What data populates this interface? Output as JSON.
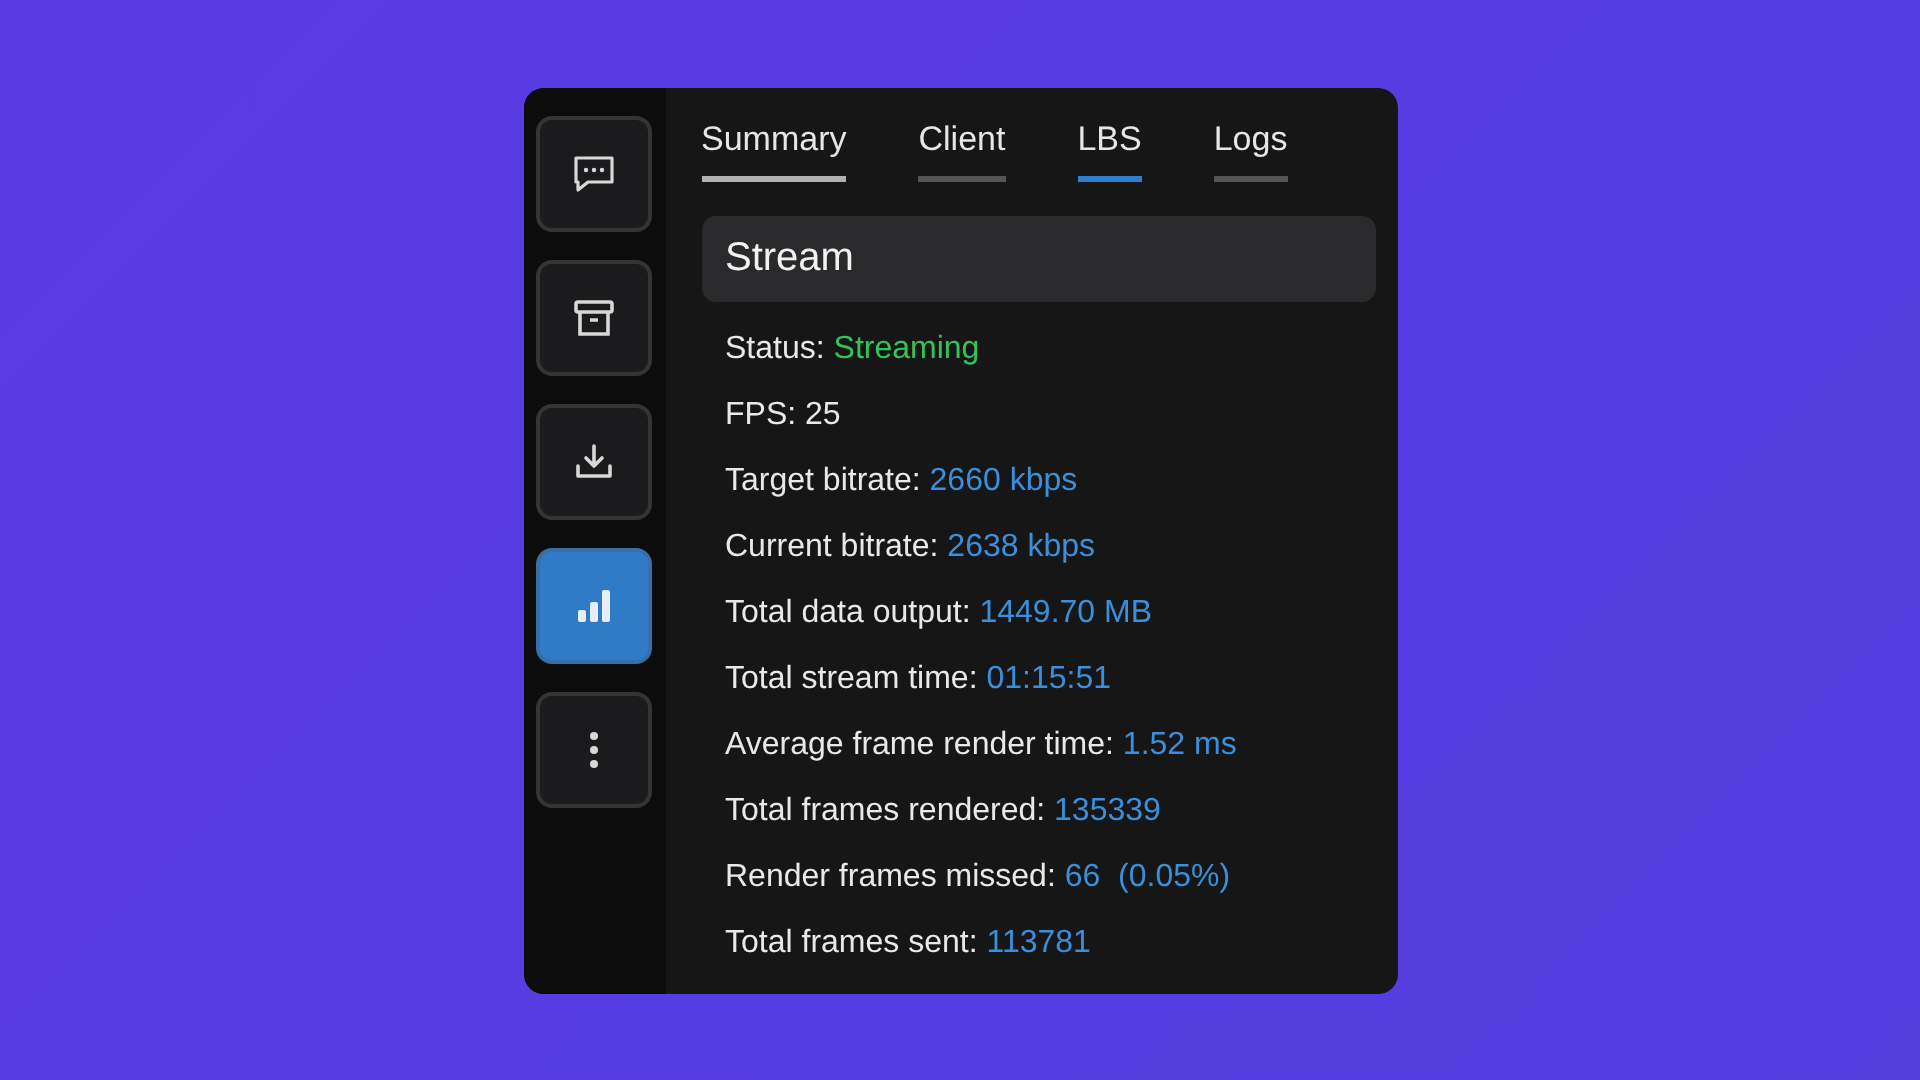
{
  "sidebar": {
    "items": [
      {
        "kind": "chat",
        "selected": false
      },
      {
        "kind": "archive",
        "selected": false
      },
      {
        "kind": "download",
        "selected": false
      },
      {
        "kind": "chart",
        "selected": true
      },
      {
        "kind": "more",
        "selected": false
      }
    ]
  },
  "tabs": [
    {
      "label": "Summary",
      "selected": false,
      "hovered": true
    },
    {
      "label": "Client",
      "selected": false,
      "hovered": false
    },
    {
      "label": "LBS",
      "selected": true,
      "hovered": false
    },
    {
      "label": "Logs",
      "selected": false,
      "hovered": false
    }
  ],
  "section": {
    "title": "Stream"
  },
  "stats": [
    {
      "label": "Status:",
      "value": "Streaming",
      "kind": "status"
    },
    {
      "label": "FPS:",
      "value": "25",
      "kind": "plain"
    },
    {
      "label": "Target bitrate:",
      "value": "2660 kbps",
      "kind": "metric"
    },
    {
      "label": "Current bitrate:",
      "value": "2638 kbps",
      "kind": "metric"
    },
    {
      "label": "Total data output:",
      "value": "1449.70 MB",
      "kind": "metric"
    },
    {
      "label": "Total stream time:",
      "value": "01:15:51",
      "kind": "metric"
    },
    {
      "label": "Average frame render time:",
      "value": "1.52 ms",
      "kind": "metric"
    },
    {
      "label": "Total frames rendered:",
      "value": "135339",
      "kind": "metric"
    },
    {
      "label": "Render frames missed:",
      "value": "66  (0.05%)",
      "kind": "metric"
    },
    {
      "label": "Total frames sent:",
      "value": "113781",
      "kind": "metric"
    }
  ]
}
